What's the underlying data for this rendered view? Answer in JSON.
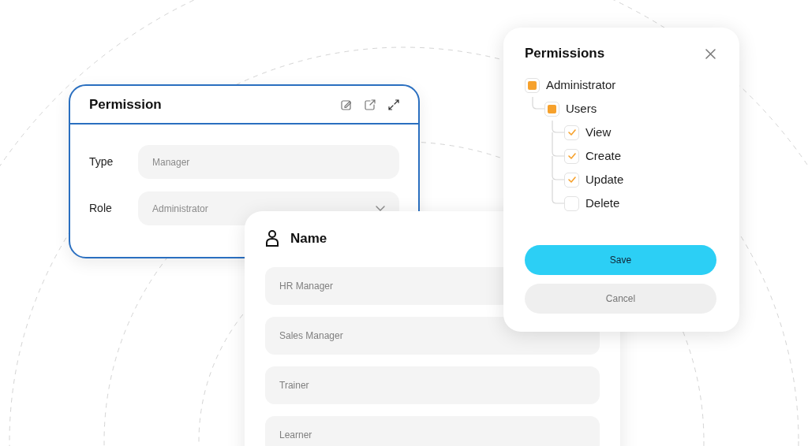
{
  "permission_card": {
    "title": "Permission",
    "fields": [
      {
        "label": "Type",
        "kind": "text",
        "value": "Manager"
      },
      {
        "label": "Role",
        "kind": "select",
        "value": "Administrator"
      }
    ]
  },
  "name_card": {
    "title": "Name",
    "items": [
      {
        "value": "HR Manager"
      },
      {
        "value": "Sales Manager"
      },
      {
        "value": "Trainer"
      },
      {
        "value": "Learner"
      }
    ]
  },
  "permissions_dialog": {
    "title": "Permissions",
    "tree": [
      {
        "label": "Administrator",
        "checked": false,
        "indeterminate": true,
        "children": [
          {
            "label": "Users",
            "checked": false,
            "indeterminate": true,
            "children": [
              {
                "label": "View",
                "checked": true
              },
              {
                "label": "Create",
                "checked": true
              },
              {
                "label": "Update",
                "checked": true
              },
              {
                "label": "Delete",
                "checked": false
              }
            ]
          }
        ]
      }
    ],
    "buttons": [
      {
        "label": "Save",
        "kind": "primary"
      },
      {
        "label": "Cancel",
        "kind": "secondary"
      }
    ]
  }
}
